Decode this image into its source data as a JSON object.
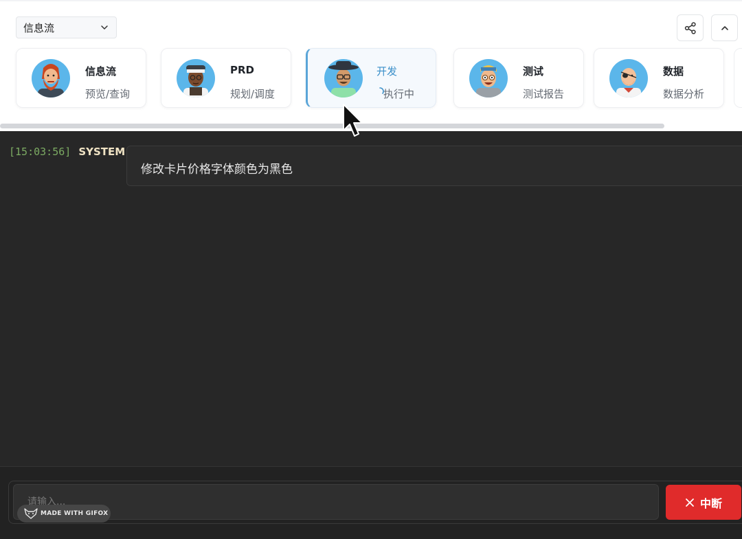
{
  "toolbar": {
    "view_select": "信息流"
  },
  "agents": [
    {
      "name": "信息流",
      "subtitle": "预览/查询"
    },
    {
      "name": "PRD",
      "subtitle": "规划/调度"
    },
    {
      "name": "开发",
      "subtitle": "执行中",
      "status": "running"
    },
    {
      "name": "测试",
      "subtitle": "测试报告"
    },
    {
      "name": "数据",
      "subtitle": "数据分析"
    }
  ],
  "log": [
    {
      "time": "[15:03:56]",
      "sender": "SYSTEM",
      "message": "修改卡片价格字体颜色为黑色"
    }
  ],
  "input": {
    "placeholder": "请输入...",
    "interrupt_label": "中断"
  },
  "watermark": "MADE WITH GIFOX",
  "colors": {
    "accent": "#3a8fc9",
    "active_border": "#5aa5d8",
    "danger": "#e02b2b",
    "timestamp": "#7cab63",
    "sender": "#f0e3c4",
    "log_bg": "#272727"
  }
}
